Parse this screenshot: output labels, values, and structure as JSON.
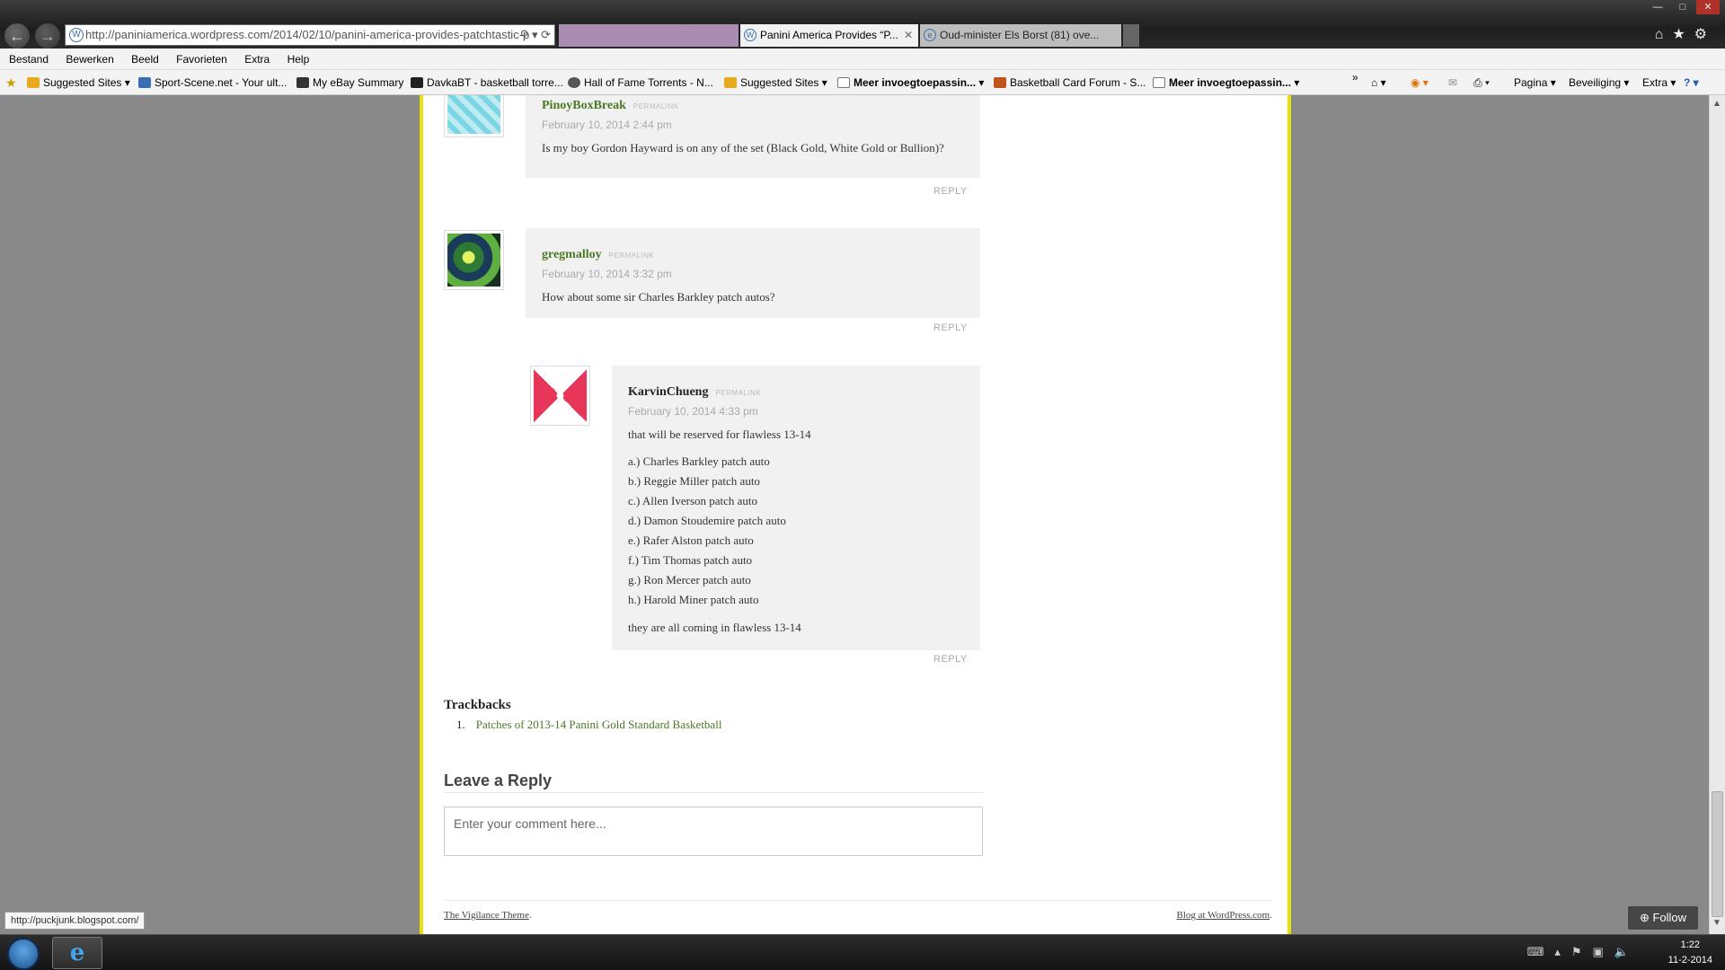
{
  "browser": {
    "url": "http://paniniamerica.wordpress.com/2014/02/10/panini-america-provides-patchtastic-p",
    "tabs": [
      {
        "label": ""
      },
      {
        "label": "Panini America Provides “P..."
      },
      {
        "label": "Oud-minister Els Borst (81) ove..."
      }
    ],
    "menu": [
      "Bestand",
      "Bewerken",
      "Beeld",
      "Favorieten",
      "Extra",
      "Help"
    ],
    "favorites": [
      {
        "label": "Suggested Sites",
        "dropdown": true
      },
      {
        "label": "Sport-Scene.net - Your ult..."
      },
      {
        "label": "My eBay Summary"
      },
      {
        "label": "DavkaBT - basketball torre..."
      },
      {
        "label": "Hall of Fame Torrents - N..."
      },
      {
        "label": "Suggested Sites",
        "dropdown": true
      },
      {
        "label": "Meer invoegtoepassin...",
        "bold": true
      },
      {
        "label": "Basketball Card Forum - S..."
      },
      {
        "label": "Meer invoegtoepassin...",
        "bold": true
      }
    ],
    "commands": [
      "Pagina",
      "Beveiliging",
      "Extra"
    ],
    "status_url": "http://puckjunk.blogspot.com/"
  },
  "comments": [
    {
      "author": "PinoyBoxBreak",
      "permalink": "PERMALINK",
      "date": "February 10, 2014 2:44 pm",
      "text": "Is my boy Gordon Hayward is on any of the set (Black Gold, White Gold or Bullion)?",
      "reply": "REPLY"
    },
    {
      "author": "gregmalloy",
      "permalink": "PERMALINK",
      "date": "February 10, 2014 3:32 pm",
      "text": "How about some sir Charles Barkley patch autos?",
      "reply": "REPLY"
    },
    {
      "author": "KarvinChueng",
      "permalink": "PERMALINK",
      "date": "February 10, 2014 4:33 pm",
      "intro": "that will be reserved for flawless 13-14",
      "list": [
        "a.) Charles Barkley patch auto",
        "b.) Reggie Miller patch auto",
        "c.) Allen Iverson patch auto",
        "d.) Damon Stoudemire patch auto",
        "e.) Rafer Alston patch auto",
        "f.) Tim Thomas patch auto",
        "g.) Ron Mercer patch auto",
        "h.) Harold Miner patch auto"
      ],
      "outro": "they are all coming in flawless 13-14",
      "reply": "REPLY"
    }
  ],
  "trackbacks": {
    "heading": "Trackbacks",
    "items": [
      {
        "num": "1.",
        "label": "Patches of 2013-14 Panini Gold Standard Basketball"
      }
    ]
  },
  "reply_form": {
    "heading": "Leave a Reply",
    "placeholder": "Enter your comment here..."
  },
  "footer": {
    "theme": "The Vigilance Theme",
    "blog": "Blog at WordPress.com"
  },
  "follow_label": "Follow",
  "clock": {
    "time": "1:22",
    "date": "11-2-2014"
  },
  "colors": {
    "accent_green": "#4a7a24",
    "page_border": "#e8e20a"
  }
}
